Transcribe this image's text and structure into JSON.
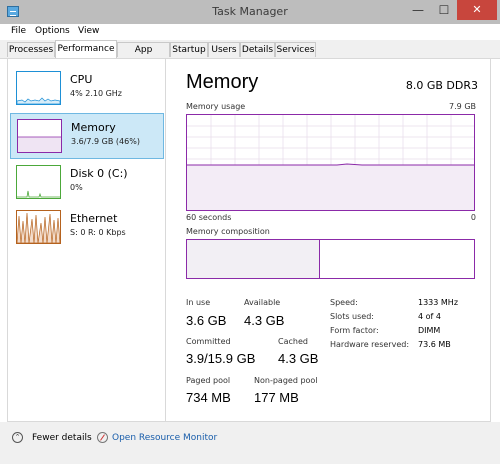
{
  "window": {
    "title": "Task Manager",
    "minimize_glyph": "—",
    "maximize_glyph": "☐",
    "close_glyph": "✕"
  },
  "menu": [
    "File",
    "Options",
    "View"
  ],
  "tabs": [
    "Processes",
    "Performance",
    "App history",
    "Startup",
    "Users",
    "Details",
    "Services"
  ],
  "active_tab": "Performance",
  "sidebar": [
    {
      "name": "CPU",
      "sub": "4% 2.10 GHz",
      "color": "#1e90d6"
    },
    {
      "name": "Memory",
      "sub": "3.6/7.9 GB (46%)",
      "color": "#8b2aa8"
    },
    {
      "name": "Disk 0 (C:)",
      "sub": "0%",
      "color": "#4ca83a"
    },
    {
      "name": "Ethernet",
      "sub": "S: 0 R: 0 Kbps",
      "color": "#b5621e"
    }
  ],
  "memory": {
    "title": "Memory",
    "total": "8.0 GB DDR3",
    "usage_label": "Memory usage",
    "usage_max": "7.9 GB",
    "time_left": "60 seconds",
    "time_right": "0",
    "composition_label": "Memory composition",
    "in_use_fraction": 0.46,
    "in_use_label": "In use",
    "in_use": "3.6 GB",
    "available_label": "Available",
    "available": "4.3 GB",
    "committed_label": "Committed",
    "committed": "3.9/15.9 GB",
    "cached_label": "Cached",
    "cached": "4.3 GB",
    "paged_pool_label": "Paged pool",
    "paged_pool": "734 MB",
    "nonpaged_pool_label": "Non-paged pool",
    "nonpaged_pool": "177 MB",
    "specs": [
      {
        "key": "Speed:",
        "value": "1333 MHz"
      },
      {
        "key": "Slots used:",
        "value": "4 of 4"
      },
      {
        "key": "Form factor:",
        "value": "DIMM"
      },
      {
        "key": "Hardware reserved:",
        "value": "73.6 MB"
      }
    ]
  },
  "footer": {
    "fewer_details": "Fewer details",
    "open_resource_monitor": "Open Resource Monitor",
    "chevron_glyph": "⌃"
  },
  "colors": {
    "memory_accent": "#8b2aa8",
    "selected_bg": "#cce8f7",
    "link": "#1a5eab",
    "close_button": "#c8463d"
  }
}
